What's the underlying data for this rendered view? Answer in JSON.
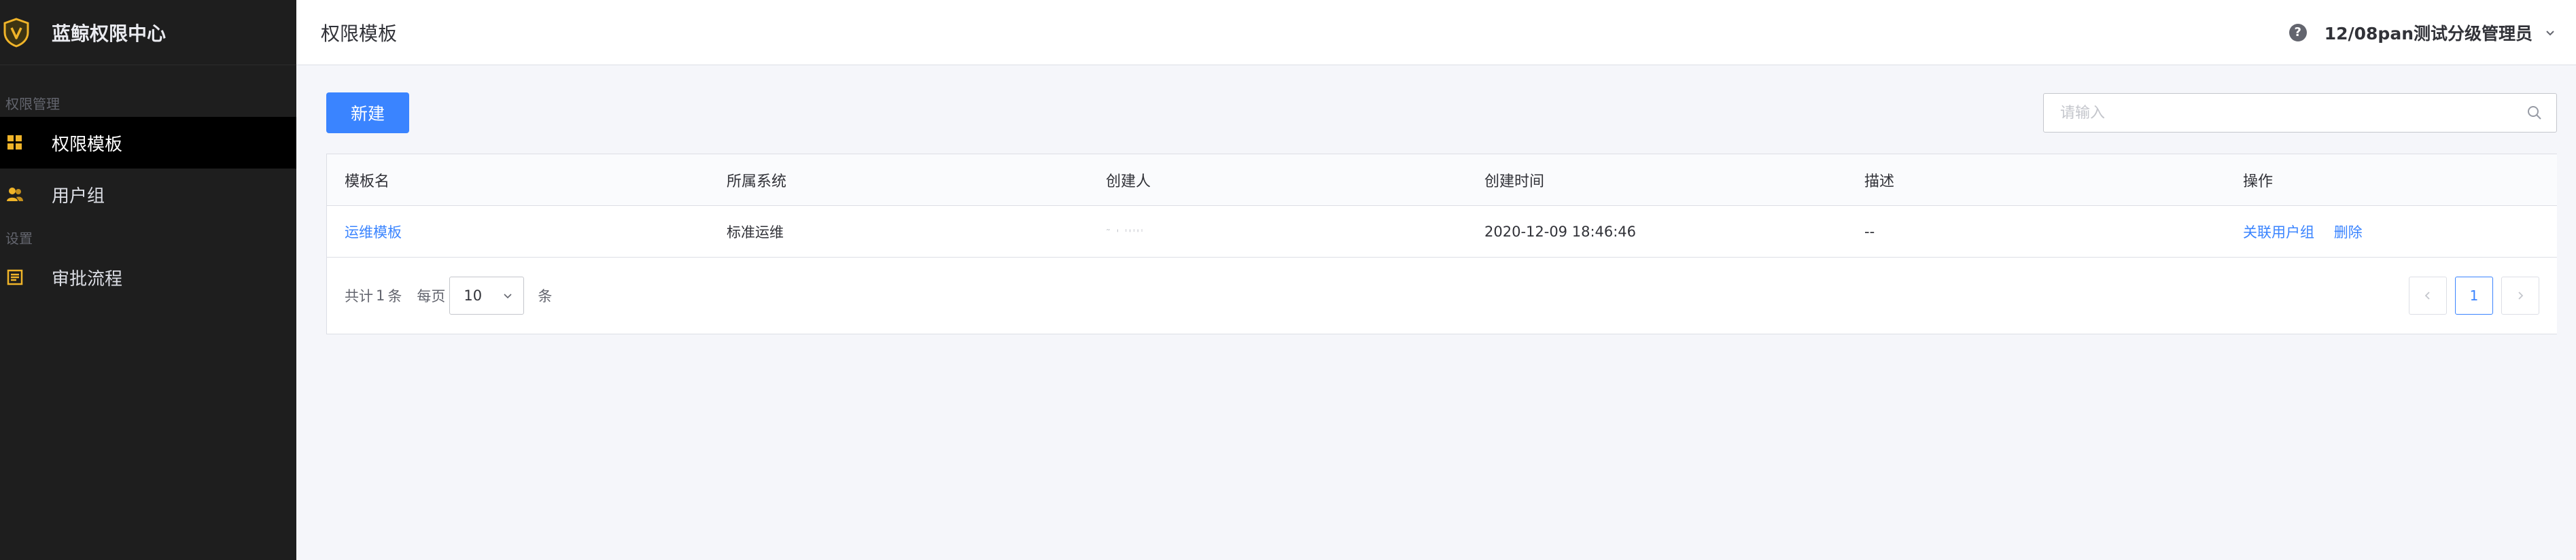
{
  "app": {
    "title": "蓝鲸权限中心"
  },
  "sidebar": {
    "groups": [
      {
        "label": "权限管理",
        "items": [
          {
            "label": "权限模板",
            "icon": "grid-icon"
          },
          {
            "label": "用户组",
            "icon": "users-icon"
          }
        ]
      },
      {
        "label": "设置",
        "items": [
          {
            "label": "审批流程",
            "icon": "approval-icon"
          }
        ]
      }
    ]
  },
  "header": {
    "page_title": "权限模板",
    "user_name": "12/08pan测试分级管理员"
  },
  "toolbar": {
    "new_label": "新建",
    "search_placeholder": "请输入"
  },
  "table": {
    "columns": [
      "模板名",
      "所属系统",
      "创建人",
      "创建时间",
      "描述",
      "操作"
    ],
    "rows": [
      {
        "name": "运维模板",
        "system": "标准运维",
        "creator": "˜ ' ˈ'ˈ'ˈ",
        "created_at": "2020-12-09 18:46:46",
        "description": "--",
        "actions": [
          "关联用户组",
          "删除"
        ]
      }
    ]
  },
  "pagination": {
    "total_prefix": "共计",
    "total": "1",
    "total_suffix": "条",
    "per_page_label": "每页",
    "page_size": "10",
    "per_page_suffix": "条",
    "current_page": "1"
  },
  "colors": {
    "sidebar_bg": "#1e1e1e",
    "primary": "#3a84ff",
    "logo_gold": "#f0b429"
  }
}
